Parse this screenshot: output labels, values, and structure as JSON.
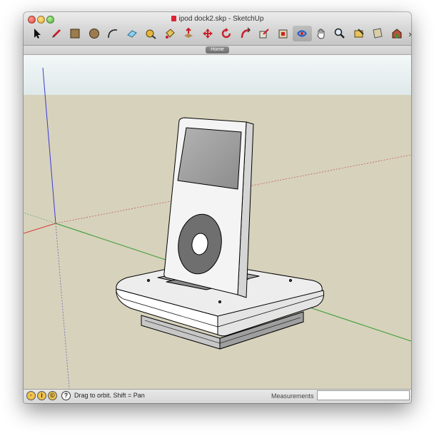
{
  "window": {
    "title": "ipod dock2.skp - SketchUp"
  },
  "toolbar": {
    "tools": [
      {
        "name": "select-tool",
        "icon": "arrow-icon"
      },
      {
        "name": "pencil-tool",
        "icon": "pencil-icon"
      },
      {
        "name": "rectangle-tool",
        "icon": "rectangle-icon"
      },
      {
        "name": "circle-tool",
        "icon": "circle-icon"
      },
      {
        "name": "arc-tool",
        "icon": "arc-icon"
      },
      {
        "name": "eraser-tool",
        "icon": "eraser-icon"
      },
      {
        "name": "tape-measure-tool",
        "icon": "tape-measure-icon"
      },
      {
        "name": "paint-bucket-tool",
        "icon": "paint-bucket-icon"
      },
      {
        "name": "push-pull-tool",
        "icon": "push-pull-icon"
      },
      {
        "name": "move-tool",
        "icon": "move-icon"
      },
      {
        "name": "rotate-tool",
        "icon": "rotate-icon"
      },
      {
        "name": "follow-me-tool",
        "icon": "follow-me-icon"
      },
      {
        "name": "scale-tool",
        "icon": "scale-icon"
      },
      {
        "name": "offset-tool",
        "icon": "offset-icon"
      },
      {
        "name": "orbit-tool",
        "icon": "orbit-icon"
      },
      {
        "name": "pan-tool",
        "icon": "hand-icon"
      },
      {
        "name": "zoom-tool",
        "icon": "magnifier-icon"
      },
      {
        "name": "zoom-extents-tool",
        "icon": "zoom-extents-icon"
      },
      {
        "name": "previous-view-tool",
        "icon": "previous-view-icon"
      },
      {
        "name": "get-models-tool",
        "icon": "warehouse-icon"
      }
    ],
    "overflow_label": "»"
  },
  "scenes": {
    "tabs": [
      {
        "label": "Home"
      }
    ]
  },
  "statusbar": {
    "icons": [
      "geo-location-icon",
      "credits-icon",
      "copyright-icon",
      "help-icon"
    ],
    "help_glyph": "?",
    "message": "Drag to orbit.  Shift = Pan",
    "measurements_label": "Measurements",
    "measurements_value": ""
  },
  "colors": {
    "sky": "#e6eeee",
    "ground": "#d7d2bc",
    "axis_red": "#d43a3a",
    "axis_green": "#2f9a2f",
    "axis_blue": "#3a3ad4"
  }
}
